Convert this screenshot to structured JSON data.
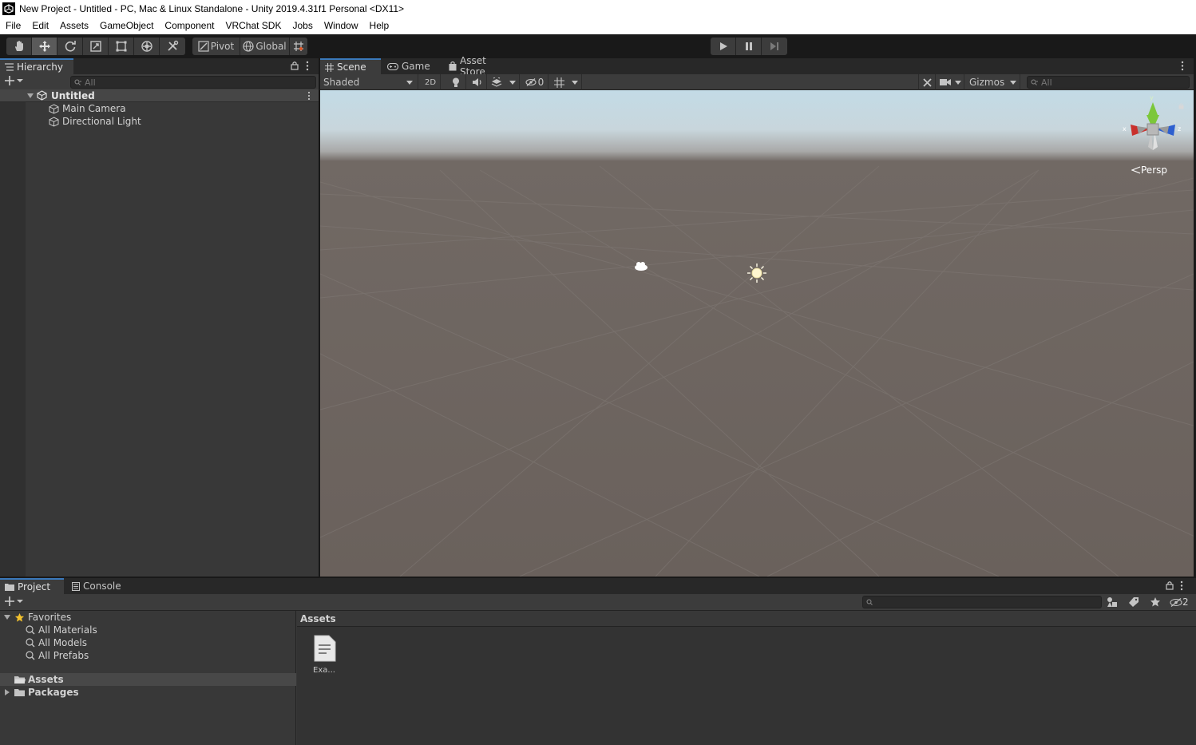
{
  "window": {
    "title": "New Project - Untitled - PC, Mac & Linux Standalone - Unity 2019.4.31f1 Personal <DX11>"
  },
  "menu": [
    "File",
    "Edit",
    "Assets",
    "GameObject",
    "Component",
    "VRChat SDK",
    "Jobs",
    "Window",
    "Help"
  ],
  "toolbar": {
    "tools": [
      "hand-tool-icon",
      "move-tool-icon",
      "rotate-tool-icon",
      "scale-tool-icon",
      "rect-tool-icon",
      "transform-tool-icon",
      "custom-tool-icon"
    ],
    "active_tool": "move-tool-icon",
    "pivot_label": "Pivot",
    "global_label": "Global"
  },
  "hierarchy": {
    "tab_label": "Hierarchy",
    "search_placeholder": "All",
    "scene_name": "Untitled",
    "objects": [
      "Main Camera",
      "Directional Light"
    ]
  },
  "scene": {
    "tabs": [
      "Scene",
      "Game",
      "Asset Store"
    ],
    "active_tab": "Scene",
    "shading_mode": "Shaded",
    "mode_2d_label": "2D",
    "hidden_count": "0",
    "gizmos_label": "Gizmos",
    "search_placeholder": "All",
    "projection_label": "Persp",
    "gizmo_axes": [
      "y",
      "x",
      "z"
    ]
  },
  "project": {
    "tabs": [
      "Project",
      "Console"
    ],
    "active_tab": "Project",
    "favorites_label": "Favorites",
    "favorites": [
      "All Materials",
      "All Models",
      "All Prefabs"
    ],
    "roots": [
      "Assets",
      "Packages"
    ],
    "selected_root": "Assets",
    "breadcrumb": "Assets",
    "hidden_count": "2",
    "files": [
      "Exa..."
    ]
  },
  "colors": {
    "accent": "#3a79bb",
    "panel": "#383838",
    "toolbar": "#191919",
    "sky_top": "#c5dde8",
    "ground": "#6b625d"
  }
}
